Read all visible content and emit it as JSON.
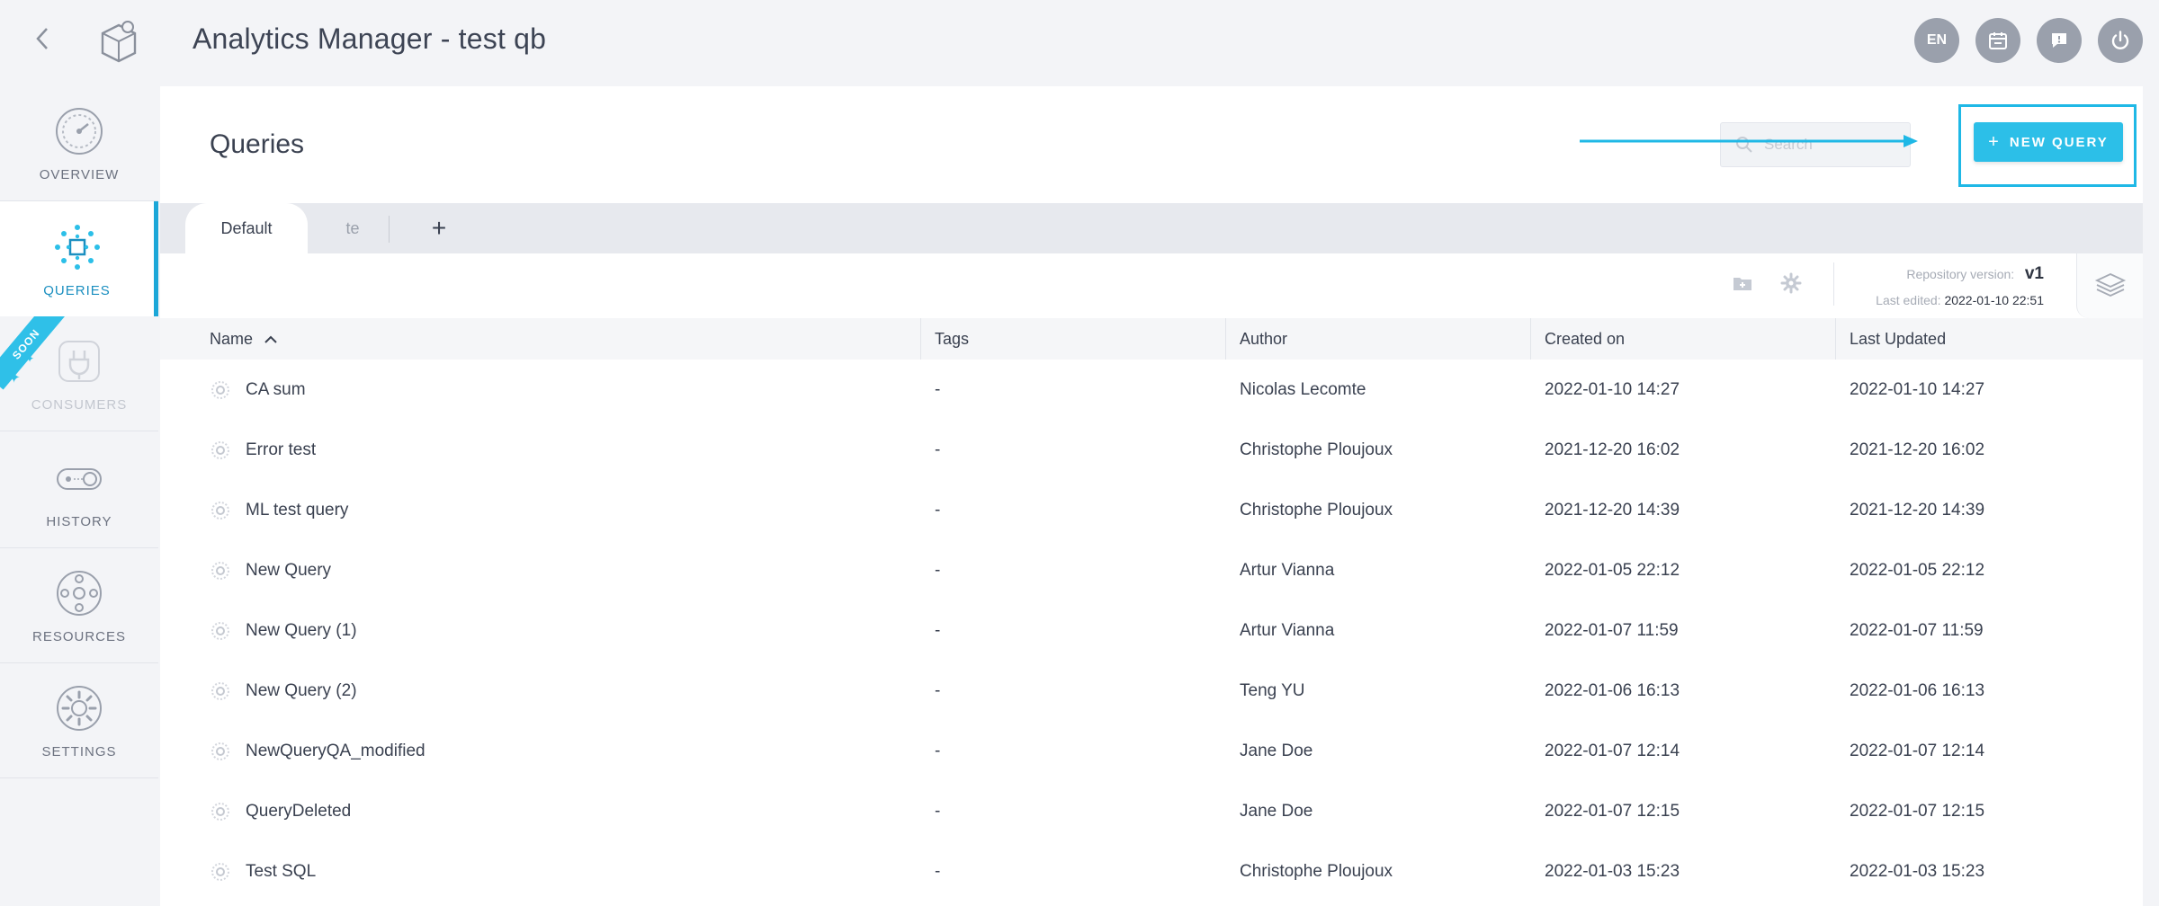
{
  "app": {
    "title": "Analytics Manager - test qb",
    "top_buttons": [
      {
        "label": "EN",
        "icon": "language-icon"
      },
      {
        "label": "",
        "icon": "calendar-icon"
      },
      {
        "label": "",
        "icon": "feedback-icon"
      },
      {
        "label": "",
        "icon": "power-icon"
      }
    ]
  },
  "sidebar": {
    "items": [
      {
        "label": "OVERVIEW",
        "icon": "overview-gauge-icon",
        "state": "normal"
      },
      {
        "label": "QUERIES",
        "icon": "queries-icon",
        "state": "active"
      },
      {
        "label": "CONSUMERS",
        "icon": "consumers-plug-icon",
        "state": "disabled",
        "badge": "SOON"
      },
      {
        "label": "HISTORY",
        "icon": "history-icon",
        "state": "normal"
      },
      {
        "label": "RESOURCES",
        "icon": "resources-icon",
        "state": "normal"
      },
      {
        "label": "SETTINGS",
        "icon": "settings-icon",
        "state": "normal"
      }
    ]
  },
  "main": {
    "title": "Queries",
    "search": {
      "placeholder": "Search",
      "value": ""
    },
    "new_query_label": "NEW QUERY",
    "tabs": [
      {
        "label": "Default",
        "active": true
      },
      {
        "label": "te",
        "active": false
      }
    ],
    "tab_add": "+",
    "repository": {
      "version_label": "Repository version:",
      "version_value": "v1",
      "edited_label": "Last edited:",
      "edited_value": "2022-01-10 22:51"
    },
    "columns": [
      "Name",
      "Tags",
      "Author",
      "Created on",
      "Last Updated"
    ],
    "rows": [
      {
        "name": "CA sum",
        "tags": "-",
        "author": "Nicolas Lecomte",
        "created": "2022-01-10 14:27",
        "updated": "2022-01-10 14:27"
      },
      {
        "name": "Error test",
        "tags": "-",
        "author": "Christophe Ploujoux",
        "created": "2021-12-20 16:02",
        "updated": "2021-12-20 16:02"
      },
      {
        "name": "ML test query",
        "tags": "-",
        "author": "Christophe Ploujoux",
        "created": "2021-12-20 14:39",
        "updated": "2021-12-20 14:39"
      },
      {
        "name": "New Query",
        "tags": "-",
        "author": "Artur Vianna",
        "created": "2022-01-05 22:12",
        "updated": "2022-01-05 22:12"
      },
      {
        "name": "New Query (1)",
        "tags": "-",
        "author": "Artur Vianna",
        "created": "2022-01-07 11:59",
        "updated": "2022-01-07 11:59"
      },
      {
        "name": "New Query (2)",
        "tags": "-",
        "author": "Teng YU",
        "created": "2022-01-06 16:13",
        "updated": "2022-01-06 16:13"
      },
      {
        "name": "NewQueryQA_modified",
        "tags": "-",
        "author": "Jane Doe",
        "created": "2022-01-07 12:14",
        "updated": "2022-01-07 12:14"
      },
      {
        "name": "QueryDeleted",
        "tags": "-",
        "author": "Jane Doe",
        "created": "2022-01-07 12:15",
        "updated": "2022-01-07 12:15"
      },
      {
        "name": "Test SQL",
        "tags": "-",
        "author": "Christophe Ploujoux",
        "created": "2022-01-03 15:23",
        "updated": "2022-01-03 15:23"
      }
    ]
  },
  "colors": {
    "accent": "#2cbfe8",
    "accent_dark": "#1b8fc0",
    "highlight_annotation": "#1fb8e6",
    "button_gray": "#9aa0ac"
  }
}
